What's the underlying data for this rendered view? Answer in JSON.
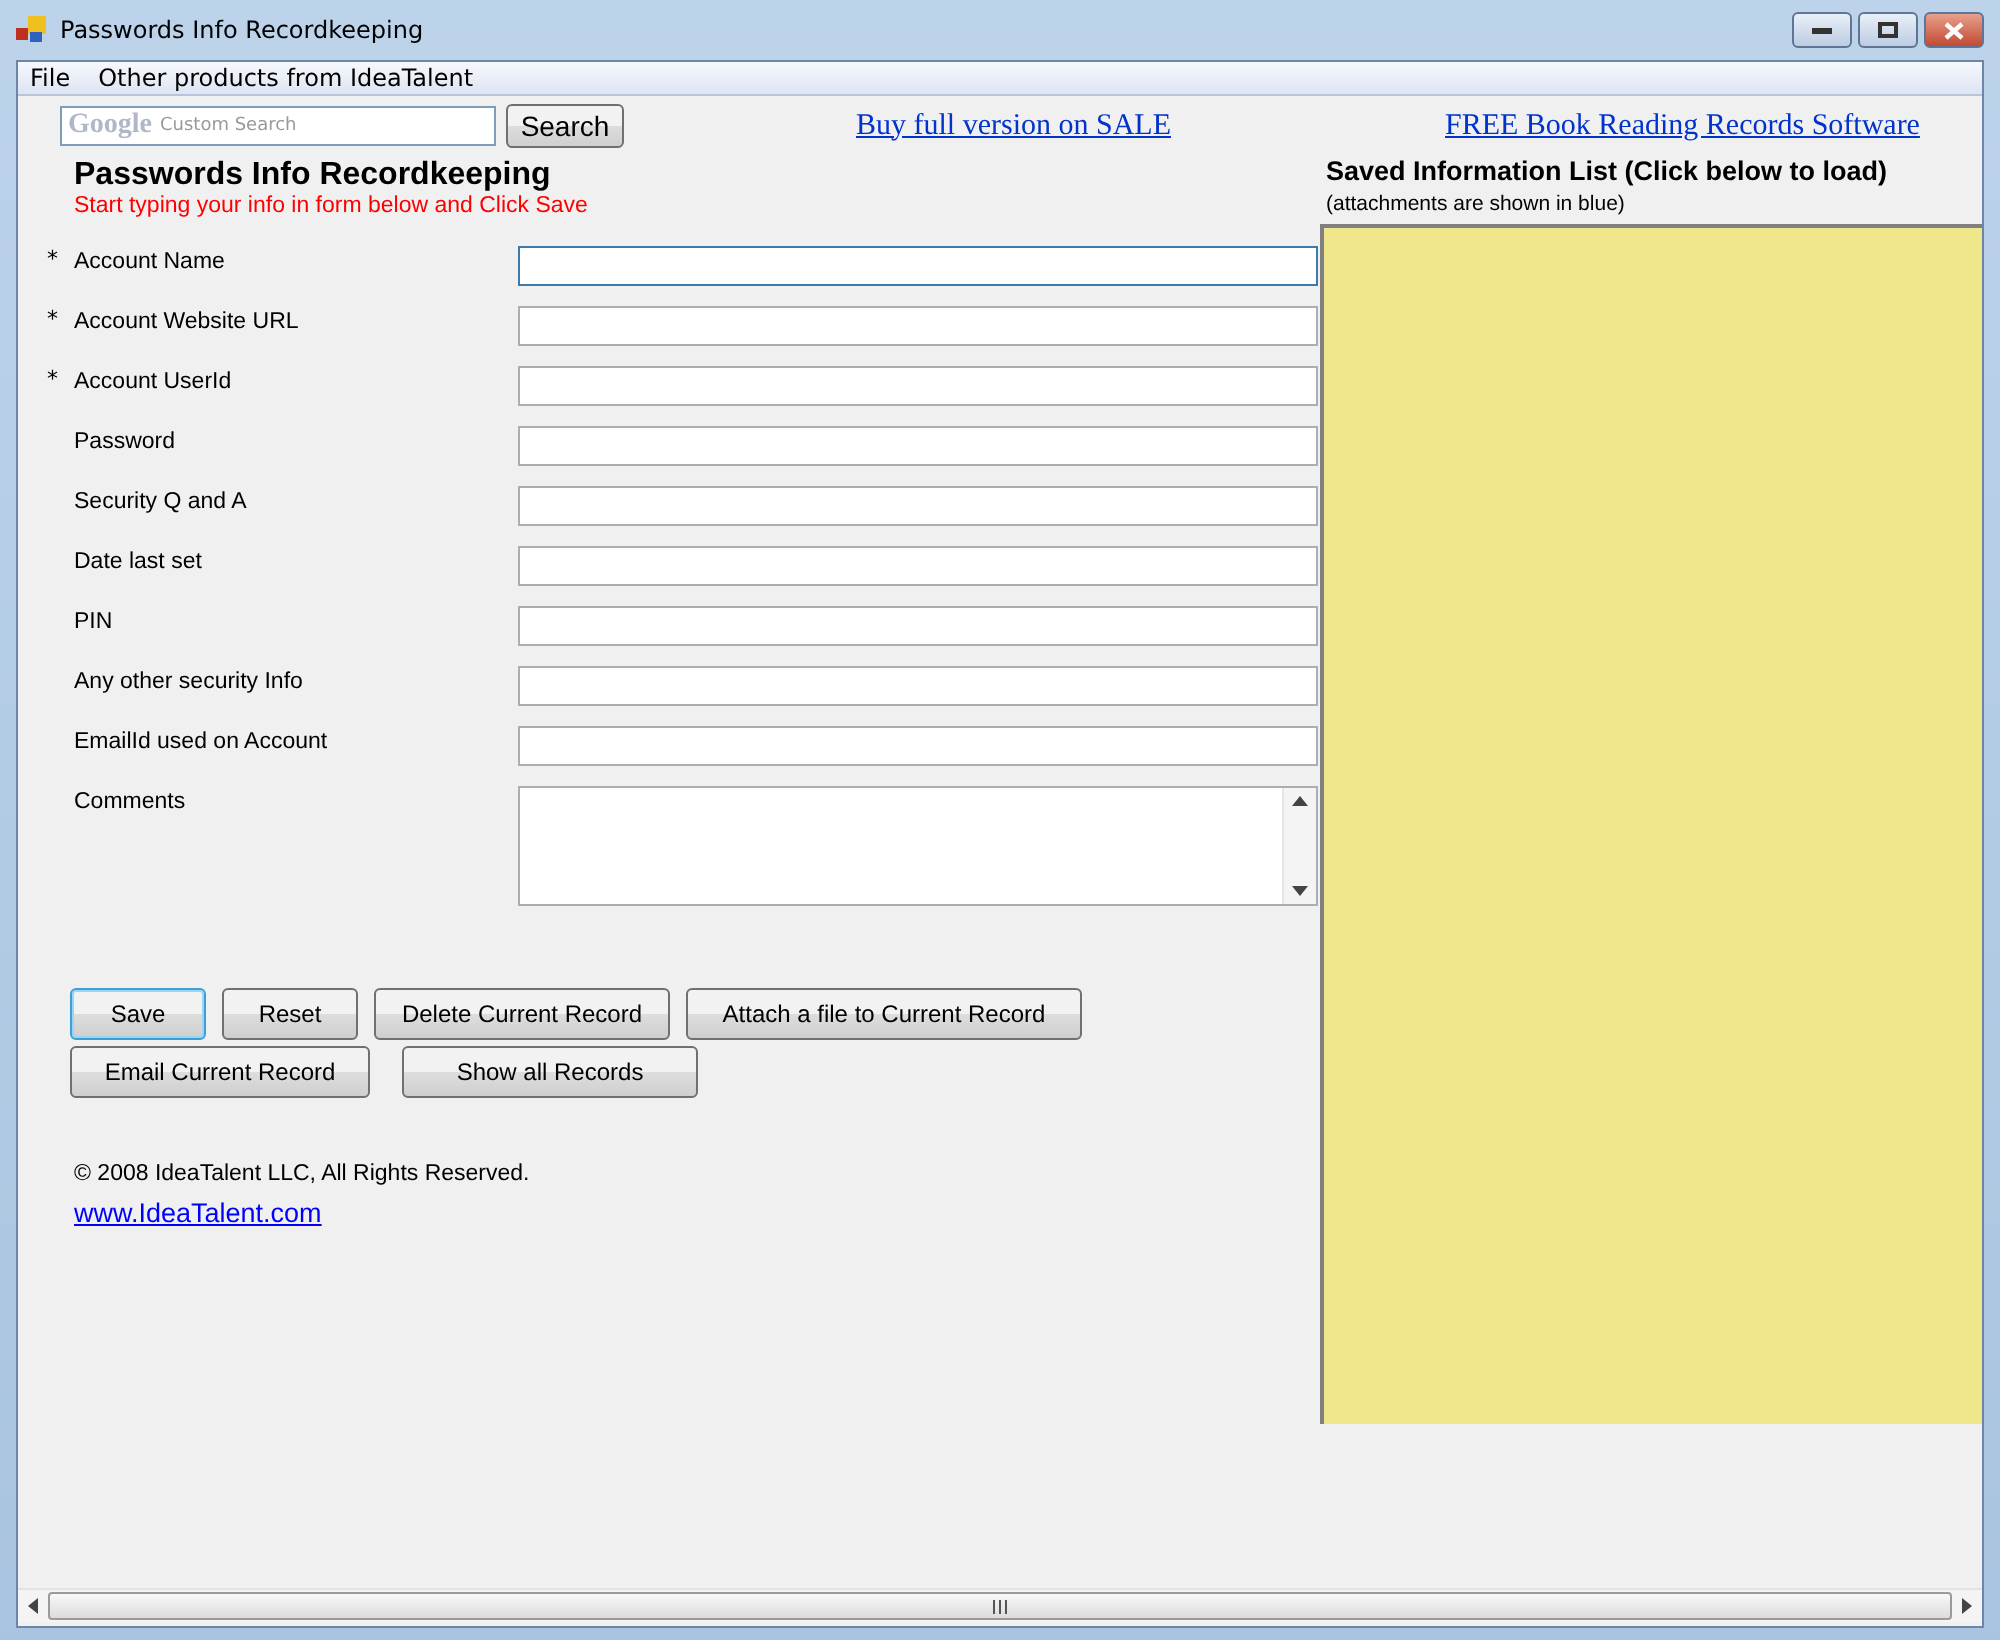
{
  "window": {
    "title": "Passwords Info Recordkeeping"
  },
  "menu": [
    "File",
    "Other products from IdeaTalent"
  ],
  "search": {
    "logo": "Google",
    "placeholder": "Custom Search",
    "button": "Search"
  },
  "required_mark": "*",
  "links": [
    "Buy full version on SALE",
    "FREE Book Reading Records Software"
  ],
  "heading": "Passwords Info Recordkeeping",
  "subheading": "Start typing your info in form below and Click Save",
  "fields": [
    {
      "label": "Account Name",
      "required": true,
      "kind": "text",
      "focused": true
    },
    {
      "label": "Account Website URL",
      "required": true,
      "kind": "text",
      "focused": false
    },
    {
      "label": "Account UserId",
      "required": true,
      "kind": "text",
      "focused": false
    },
    {
      "label": "Password",
      "required": false,
      "kind": "text",
      "focused": false
    },
    {
      "label": "Security Q and A",
      "required": false,
      "kind": "text",
      "focused": false
    },
    {
      "label": "Date last set",
      "required": false,
      "kind": "text",
      "focused": false
    },
    {
      "label": "PIN",
      "required": false,
      "kind": "text",
      "focused": false
    },
    {
      "label": "Any other security Info",
      "required": false,
      "kind": "text",
      "focused": false
    },
    {
      "label": "EmailId used on Account",
      "required": false,
      "kind": "text",
      "focused": false
    },
    {
      "label": "Comments",
      "required": false,
      "kind": "multiline",
      "focused": false
    }
  ],
  "button_rows": [
    [
      {
        "label": "Save",
        "default": true
      },
      {
        "label": "Reset",
        "default": false
      },
      {
        "label": "Delete Current Record",
        "default": false
      },
      {
        "label": "Attach a file to Current Record",
        "default": false
      }
    ],
    [
      {
        "label": "Email Current Record",
        "default": false
      },
      {
        "label": "Show all Records",
        "default": false
      }
    ]
  ],
  "copyright": "© 2008 IdeaTalent LLC, All Rights Reserved.",
  "website": "www.IdeaTalent.com",
  "saved_list": {
    "title": "Saved Information List (Click below to load)",
    "note": "(attachments are shown in blue)"
  }
}
